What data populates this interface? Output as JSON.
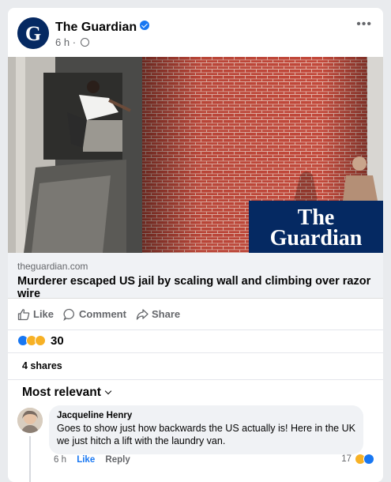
{
  "post": {
    "page_name": "The Guardian",
    "time": "6 h",
    "menu": "•••"
  },
  "link": {
    "domain": "theguardian.com",
    "headline": "Murderer escaped US jail by scaling wall and climbing over razor wire",
    "watermark_line1": "The",
    "watermark_line2": "Guardian"
  },
  "actions": {
    "like": "Like",
    "comment": "Comment",
    "share": "Share"
  },
  "reactions": {
    "count": "30",
    "types": [
      "like",
      "wow",
      "haha"
    ]
  },
  "shares": "4 shares",
  "comments": {
    "sort_label": "Most relevant",
    "items": [
      {
        "author": "Jacqueline Henry",
        "text": "Goes to show just how backwards the US actually is! Here in the UK we just hitch a lift with the laundry van.",
        "time": "6 h",
        "like": "Like",
        "reply": "Reply",
        "reaction_count": "17"
      }
    ]
  },
  "colors": {
    "brand": "#052962",
    "accent": "#1877f2",
    "brick": "#c2483a"
  }
}
